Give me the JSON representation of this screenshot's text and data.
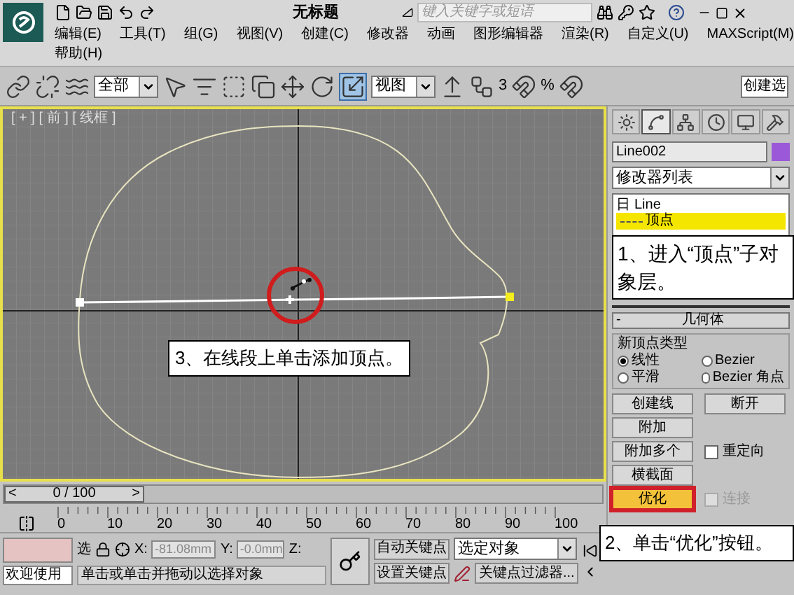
{
  "window": {
    "title": "无标题",
    "search": {
      "placeholder": "键入关键字或短语"
    }
  },
  "menu": {
    "rows": [
      [
        "编辑(E)",
        "工具(T)",
        "组(G)",
        "视图(V)",
        "创建(C)",
        "修改器",
        "动画",
        "图形编辑器",
        "渲染(R)",
        "自定义(U)",
        "MAXScript(M)"
      ],
      [
        "帮助(H)"
      ]
    ]
  },
  "toolbar": {
    "selection_filter": "全部",
    "reference_coord": "视图",
    "snap_labels": [
      "3",
      "%"
    ],
    "named_selection": "创建选"
  },
  "viewport": {
    "label": "[ + ] [ 前 ] [ 线框 ]",
    "active": true
  },
  "command_panel": {
    "tabs": [
      {
        "kind": "sun",
        "selected": false
      },
      {
        "kind": "curve",
        "selected": true
      },
      {
        "kind": "hierarchy",
        "selected": false
      },
      {
        "kind": "clock",
        "selected": false
      },
      {
        "kind": "monitor",
        "selected": false
      },
      {
        "kind": "hammer",
        "selected": false
      }
    ],
    "object_name": "Line002",
    "modifier_list": "修改器列表",
    "stack": [
      {
        "label": "Line",
        "toggle": "日",
        "selected": false,
        "children": [
          {
            "label": "顶点",
            "selected": true
          }
        ]
      }
    ],
    "rollout": {
      "toggle": "-",
      "title": "几何体",
      "vertex_type": {
        "title": "新顶点类型",
        "options": [
          {
            "label": "线性",
            "selected": true
          },
          {
            "label": "Bezier",
            "selected": false
          },
          {
            "label": "平滑",
            "selected": false
          },
          {
            "label": "Bezier 角点",
            "selected": false
          }
        ]
      },
      "rows": [
        [
          {
            "kind": "button",
            "label": "创建线",
            "selected": false
          },
          {
            "kind": "button",
            "label": "断开",
            "selected": false
          }
        ],
        [
          {
            "kind": "button",
            "label": "附加",
            "selected": false
          }
        ],
        [
          {
            "kind": "button",
            "label": "附加多个",
            "selected": false
          },
          {
            "kind": "checkbox",
            "label": "重定向",
            "checked": false,
            "disabled": false
          }
        ],
        [
          {
            "kind": "button",
            "label": "横截面",
            "selected": false
          }
        ],
        [
          {
            "kind": "button",
            "label": "优化",
            "selected": true
          },
          {
            "kind": "checkbox",
            "label": "连接",
            "checked": false,
            "disabled": true
          }
        ]
      ]
    }
  },
  "timeline": {
    "position": "0 / 100",
    "level": 0,
    "prev": "<",
    "next": ">",
    "ticks": [
      "0",
      "10",
      "20",
      "30",
      "40",
      "50",
      "60",
      "70",
      "80",
      "90",
      "100"
    ]
  },
  "status_bar": {
    "welcome": "欢迎使用",
    "selection_label": "选",
    "x": {
      "label": "X:",
      "value": "-81.08mm"
    },
    "y": {
      "label": "Y:",
      "value": "-0.0mm"
    },
    "z": {
      "label": "Z:"
    },
    "auto_key": "自动关键点",
    "key_mode": "选定对象",
    "set_key": "设置关键点",
    "key_filters": "关键点过滤器...",
    "prompt": "单击或单击并拖动以选择对象"
  },
  "annotations": [
    {
      "text": "1、进入“顶点”子对象层。"
    },
    {
      "text": "2、单击“优化”按钮。"
    },
    {
      "text": "3、在线段上单击添加顶点。"
    }
  ]
}
